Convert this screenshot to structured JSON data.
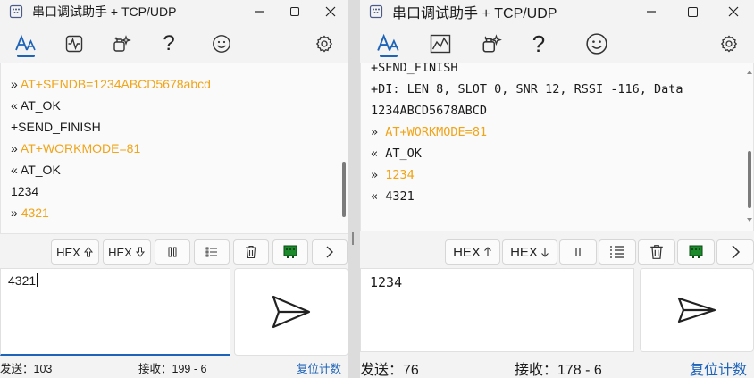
{
  "colors": {
    "accent": "#1d63b8",
    "sent_text": "#f0a417"
  },
  "left": {
    "title": "串口调试助手 + TCP/UDP",
    "toolbar_icons": [
      "text-format-icon",
      "waveform-icon",
      "magic-icon",
      "help-icon",
      "smiley-icon",
      "gear-icon"
    ],
    "help_glyph": "?",
    "log": [
      {
        "prefix": "»",
        "text": "AT+SENDB=1234ABCD5678abcd",
        "sent": true
      },
      {
        "prefix": "«",
        "text": "AT_OK",
        "sent": false
      },
      {
        "prefix": "",
        "text": "+SEND_FINISH",
        "sent": false
      },
      {
        "prefix": "»",
        "text": "AT+WORKMODE=81",
        "sent": true
      },
      {
        "prefix": "«",
        "text": "AT_OK",
        "sent": false
      },
      {
        "prefix": "",
        "text": "1234",
        "sent": false
      },
      {
        "prefix": "»",
        "text": "4321",
        "sent": true
      }
    ],
    "hex_send_label": "HEX",
    "hex_recv_label": "HEX",
    "input_value": "4321",
    "sent_label": "发送：103",
    "recv_label": "接收：199 - 6",
    "reset_label": "复位计数"
  },
  "right": {
    "title": "串口调试助手 + TCP/UDP",
    "toolbar_icons": [
      "text-format-icon",
      "chart-icon",
      "magic-icon",
      "help-icon",
      "smiley-icon",
      "gear-icon"
    ],
    "help_glyph": "?",
    "log": [
      {
        "prefix": "",
        "text": "+SEND_FINISH",
        "sent": false
      },
      {
        "prefix": "",
        "text": "+DI: LEN 8, SLOT 0, SNR 12, RSSI -116, Data",
        "sent": false
      },
      {
        "prefix": "",
        "text": "1234ABCD5678ABCD",
        "sent": false
      },
      {
        "prefix": "»",
        "text": "AT+WORKMODE=81",
        "sent": true
      },
      {
        "prefix": "«",
        "text": "AT_OK",
        "sent": false
      },
      {
        "prefix": "»",
        "text": "1234",
        "sent": true
      },
      {
        "prefix": "«",
        "text": "4321",
        "sent": false
      }
    ],
    "hex_send_label": "HEX",
    "hex_recv_label": "HEX",
    "input_value": "1234",
    "sent_label": "发送：76",
    "recv_label": "接收：178 - 6",
    "reset_label": "复位计数"
  }
}
